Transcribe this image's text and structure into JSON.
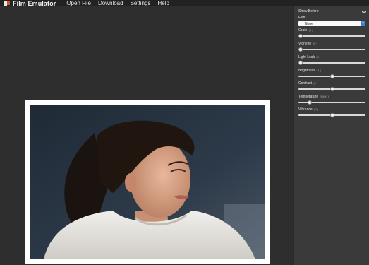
{
  "app": {
    "title": "Film Emulator"
  },
  "menu": {
    "items": [
      "Open File",
      "Download",
      "Settings",
      "Help"
    ]
  },
  "panel": {
    "show_before": "Show Before",
    "film": {
      "label": "Film",
      "selected": "None"
    },
    "sliders": [
      {
        "label": "Grain",
        "value": "0",
        "fraction": 0.0
      },
      {
        "label": "Vignette",
        "value": "0",
        "fraction": 0.0
      },
      {
        "label": "Light Leak",
        "value": "0",
        "fraction": 0.0
      },
      {
        "label": "Brightness",
        "value": "1",
        "fraction": 0.5
      },
      {
        "label": "Contrast",
        "value": "0",
        "fraction": 0.5
      },
      {
        "label": "Temperature",
        "value": "6500",
        "fraction": 0.15
      },
      {
        "label": "Vibrance",
        "value": "0",
        "fraction": 0.5
      }
    ]
  },
  "colors": {
    "accent": "#3c7de0",
    "logo_orange": "#d9542b",
    "panel_bg": "#3a3a3a",
    "workspace_bg": "#2e2e2e"
  }
}
